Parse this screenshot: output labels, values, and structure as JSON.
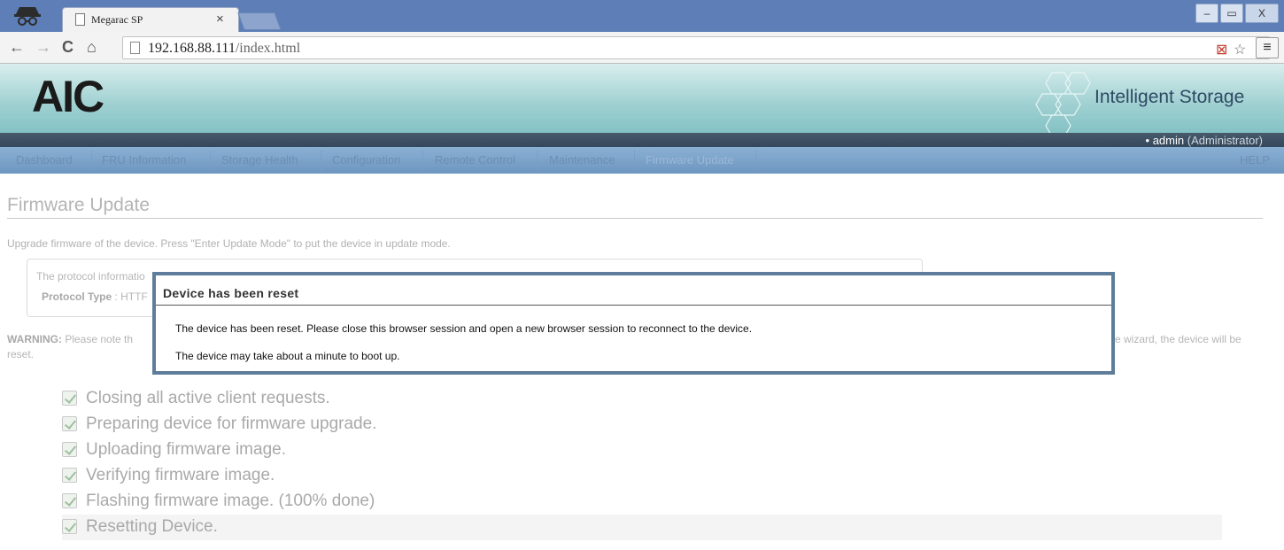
{
  "browser": {
    "tab_title": "Megarac SP",
    "tab_close": "×",
    "url_host": "192.168.88.111",
    "url_path": "/index.html",
    "window_controls": [
      "–",
      "▭",
      "X"
    ],
    "nav": {
      "back": "←",
      "forward": "→",
      "reload": "C",
      "home": "⌂"
    },
    "menu": "≡",
    "star": "☆",
    "blocked_icon": "⊠"
  },
  "header": {
    "logo": "AIC",
    "tagline": "Intelligent Storage",
    "user_bullet": "•",
    "user_name": "admin",
    "user_role": "(Administrator)"
  },
  "nav_items": [
    "Dashboard",
    "FRU Information",
    "Storage Health",
    "Configuration",
    "Remote Control",
    "Maintenance",
    "Firmware Update"
  ],
  "nav_help": "HELP",
  "page": {
    "title": "Firmware Update",
    "description": "Upgrade firmware of the device. Press \"Enter Update Mode\" to put the device in update mode.",
    "protocol_info": "The protocol informatio",
    "protocol_label": "Protocol Type",
    "protocol_value": " : HTTF",
    "warning_label": "WARNING:",
    "warning_text": " Please note th",
    "warning_tail": "e wizard, the device will be",
    "warning_line2": "reset."
  },
  "steps": [
    "Closing all active client requests.",
    "Preparing device for firmware upgrade.",
    "Uploading firmware image.",
    "Verifying firmware image.",
    "Flashing firmware image. (100% done)",
    "Resetting Device."
  ],
  "modal": {
    "title": "Device has been reset",
    "message1": "The device has been reset. Please close this browser session and open a new browser session to reconnect to the device.",
    "message2": "The device may take about a minute to boot up."
  },
  "colors": {
    "titlebar": "#5d7eb6",
    "navbar": "#6d96c0",
    "modal_border": "#5e7d9b"
  }
}
